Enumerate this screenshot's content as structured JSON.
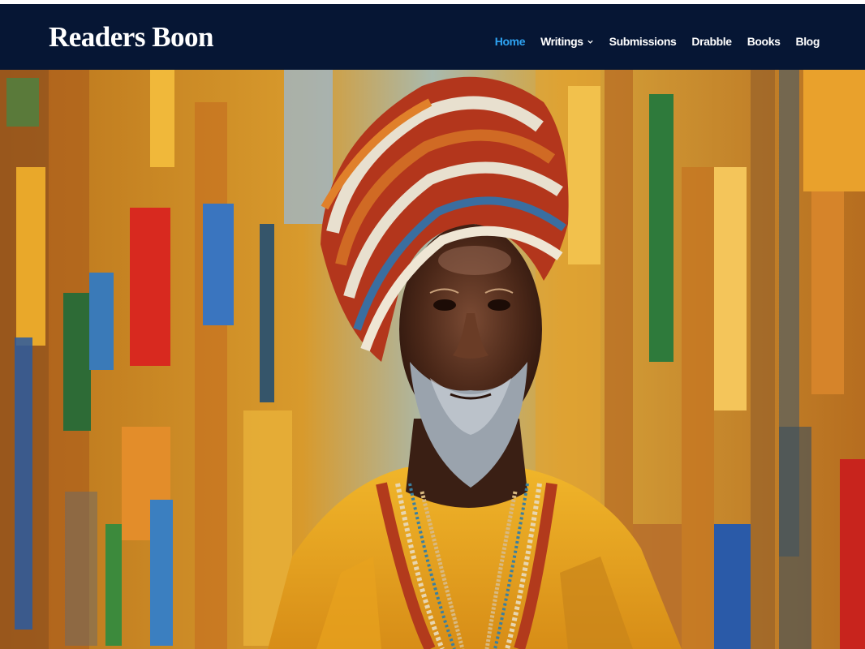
{
  "site": {
    "name": "Readers Boon"
  },
  "nav": {
    "items": [
      {
        "label": "Home",
        "active": true,
        "has_dropdown": false
      },
      {
        "label": "Writings",
        "active": false,
        "has_dropdown": true
      },
      {
        "label": "Submissions",
        "active": false,
        "has_dropdown": false
      },
      {
        "label": "Drabble",
        "active": false,
        "has_dropdown": false
      },
      {
        "label": "Books",
        "active": false,
        "has_dropdown": false
      },
      {
        "label": "Blog",
        "active": false,
        "has_dropdown": false
      }
    ],
    "dropdown_icon": "chevron-down-icon"
  },
  "hero": {
    "image_subject": "painting of elderly man in striped turban and yellow robe with bead necklaces"
  },
  "colors": {
    "header_bg": "#061634",
    "nav_text": "#ffffff",
    "nav_active": "#2ea3f2",
    "logo_text": "#ffffff"
  }
}
